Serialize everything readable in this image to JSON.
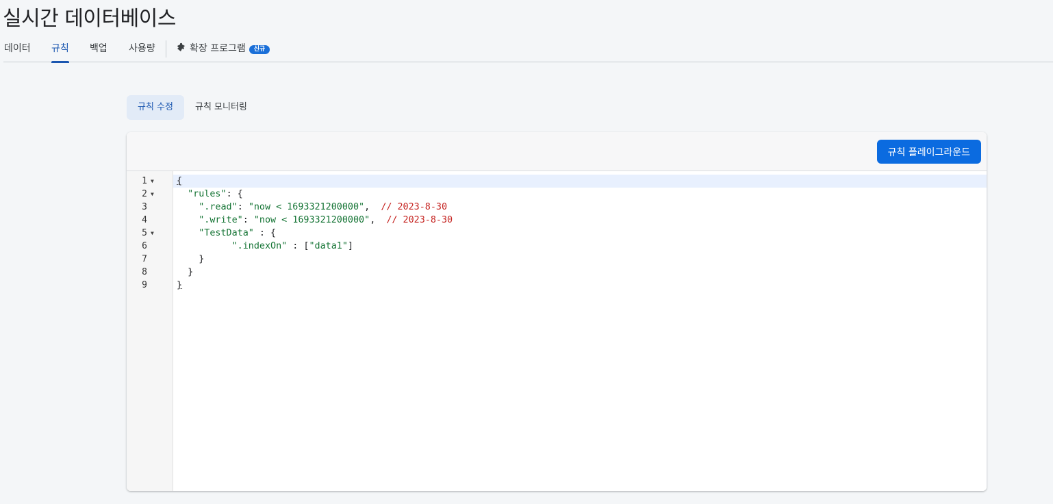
{
  "page": {
    "title": "실시간 데이터베이스"
  },
  "nav": {
    "tabs": [
      {
        "label": "데이터"
      },
      {
        "label": "규칙"
      },
      {
        "label": "백업"
      },
      {
        "label": "사용량"
      }
    ],
    "extensions": {
      "label": "확장 프로그램",
      "badge": "신규",
      "icon": "extension-icon"
    }
  },
  "subtabs": [
    {
      "label": "규칙 수정",
      "active": true
    },
    {
      "label": "규칙 모니터링",
      "active": false
    }
  ],
  "toolbar": {
    "playground_label": "규칙 플레이그라운드"
  },
  "editor": {
    "lines": [
      {
        "num": "1",
        "fold": true
      },
      {
        "num": "2",
        "fold": true
      },
      {
        "num": "3",
        "fold": false
      },
      {
        "num": "4",
        "fold": false
      },
      {
        "num": "5",
        "fold": true
      },
      {
        "num": "6",
        "fold": false
      },
      {
        "num": "7",
        "fold": false
      },
      {
        "num": "8",
        "fold": false
      },
      {
        "num": "9",
        "fold": false
      }
    ],
    "tokens": {
      "open_brace": "{",
      "rules_key": "\"rules\"",
      "rules_sep": ": {",
      "read_key": "\".read\"",
      "read_value": "\"now < 1693321200000\"",
      "read_comment": "// 2023-8-30",
      "write_key": "\".write\"",
      "write_value": "\"now < 1693321200000\"",
      "write_comment": "// 2023-8-30",
      "testdata_key": "\"TestData\"",
      "testdata_sep": " : {",
      "indexon_key": "\".indexOn\"",
      "indexon_sep": " : [",
      "indexon_value": "\"data1\"",
      "indexon_close": "]",
      "close_inner": "}",
      "close_rules": "}",
      "close_brace": "}"
    }
  },
  "colors": {
    "accent": "#1a56b0",
    "button": "#0b6be0",
    "string": "#137333",
    "comment": "#c5221f"
  }
}
